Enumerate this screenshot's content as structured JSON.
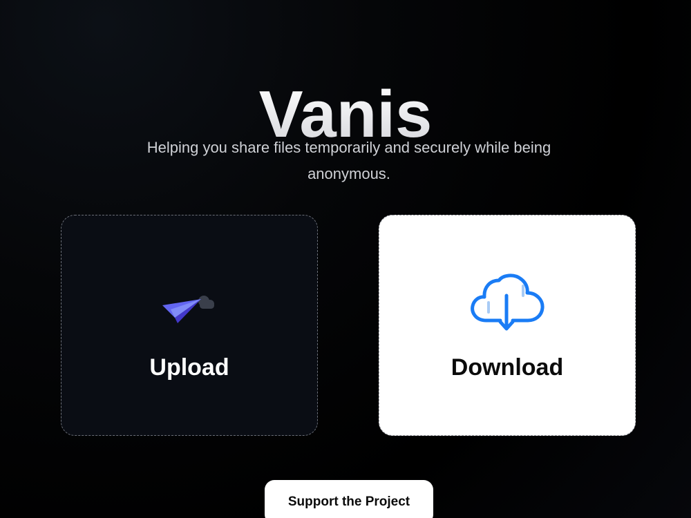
{
  "app": {
    "title": "Vanis",
    "tagline": "Helping you share files temporarily and securely while being anonymous."
  },
  "cards": {
    "upload": {
      "label": "Upload",
      "icon": "paper-plane-icon"
    },
    "download": {
      "label": "Download",
      "icon": "cloud-download-icon"
    }
  },
  "support": {
    "label": "Support the Project"
  },
  "colors": {
    "background": "#000000",
    "upload_card": "#0a0d14",
    "download_card": "#ffffff",
    "plane": "#6366f1",
    "cloud_stroke": "#1a7cf5"
  }
}
